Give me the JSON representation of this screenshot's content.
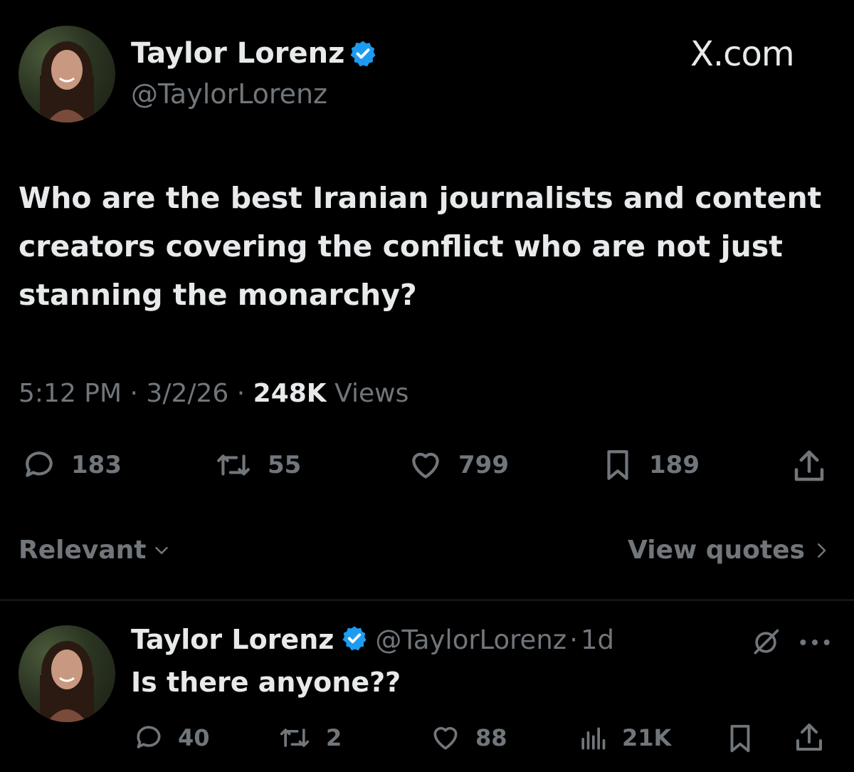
{
  "main_tweet": {
    "author_name": "Taylor Lorenz",
    "author_handle": "@TaylorLorenz",
    "site_label": "X.com",
    "text": "Who are the best Iranian journalists and content creators covering the conflict who are not just stanning the monarchy?",
    "time": "5:12 PM",
    "date": "3/2/26",
    "views_count": "248K",
    "views_label": "Views",
    "sep": "·",
    "replies": "183",
    "reposts": "55",
    "likes": "799",
    "bookmarks": "189"
  },
  "sort_bar": {
    "sort_label": "Relevant",
    "view_quotes_label": "View quotes"
  },
  "reply": {
    "author_name": "Taylor Lorenz",
    "author_handle": "@TaylorLorenz",
    "age": "1d",
    "sep": "·",
    "text": "Is there anyone??",
    "replies": "40",
    "reposts": "2",
    "likes": "88",
    "views": "21K"
  },
  "colors": {
    "background": "#000000",
    "text": "#e7e9ea",
    "muted": "#71767b",
    "verified": "#1d9bf0"
  },
  "icons": [
    "verified-badge-icon",
    "reply-icon",
    "repost-icon",
    "like-icon",
    "bookmark-icon",
    "share-icon",
    "chevron-down-icon",
    "chevron-right-icon",
    "grok-icon",
    "more-icon",
    "views-icon"
  ]
}
